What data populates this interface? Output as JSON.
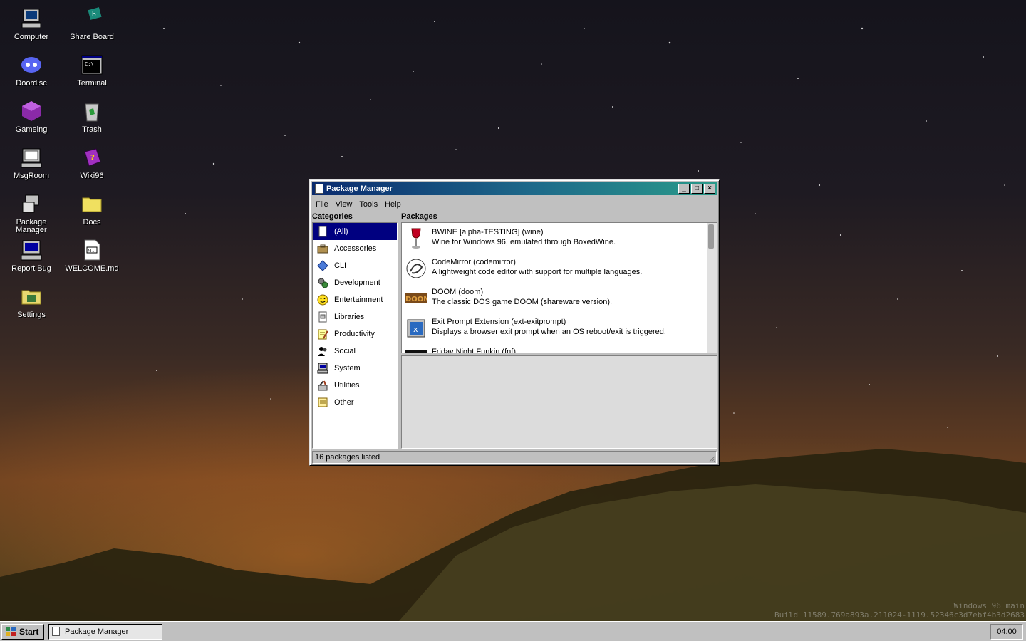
{
  "desktop": {
    "icons": [
      {
        "label": "Computer",
        "icon": "computer-icon"
      },
      {
        "label": "Share Board",
        "icon": "share-board-icon"
      },
      {
        "label": "Doordisc",
        "icon": "doordisc-icon"
      },
      {
        "label": "Terminal",
        "icon": "terminal-icon"
      },
      {
        "label": "Gameing",
        "icon": "gameing-icon"
      },
      {
        "label": "Trash",
        "icon": "trash-icon"
      },
      {
        "label": "MsgRoom",
        "icon": "msgroom-icon"
      },
      {
        "label": "Wiki96",
        "icon": "wiki-icon"
      },
      {
        "label": "Package Manager",
        "icon": "package-manager-icon"
      },
      {
        "label": "Docs",
        "icon": "folder-icon"
      },
      {
        "label": "Report Bug",
        "icon": "report-bug-icon"
      },
      {
        "label": "WELCOME.md",
        "icon": "markdown-file-icon"
      },
      {
        "label": "Settings",
        "icon": "settings-icon"
      }
    ]
  },
  "window": {
    "title": "Package Manager",
    "menu": [
      "File",
      "View",
      "Tools",
      "Help"
    ],
    "categories_label": "Categories",
    "packages_label": "Packages",
    "categories": [
      {
        "label": "(All)",
        "selected": true
      },
      {
        "label": "Accessories"
      },
      {
        "label": "CLI"
      },
      {
        "label": "Development"
      },
      {
        "label": "Entertainment"
      },
      {
        "label": "Libraries"
      },
      {
        "label": "Productivity"
      },
      {
        "label": "Social"
      },
      {
        "label": "System"
      },
      {
        "label": "Utilities"
      },
      {
        "label": "Other"
      }
    ],
    "packages": [
      {
        "name": "BWINE [alpha-TESTING] (wine)",
        "desc": "Wine for Windows 96, emulated through BoxedWine.",
        "icon": "wine-glass-icon"
      },
      {
        "name": "CodeMirror (codemirror)",
        "desc": "A lightweight code editor with support for multiple languages.",
        "icon": "codemirror-icon"
      },
      {
        "name": "DOOM (doom)",
        "desc": "The classic DOS game DOOM (shareware version).",
        "icon": "doom-icon"
      },
      {
        "name": "Exit Prompt Extension (ext-exitprompt)",
        "desc": "Displays a browser exit prompt when an OS reboot/exit is triggered.",
        "icon": "exit-prompt-icon"
      },
      {
        "name": "Friday Night Funkin (fnf)",
        "desc": "",
        "icon": "fnf-icon"
      }
    ],
    "status": "16 packages listed"
  },
  "watermark": {
    "line1": "Windows 96 main",
    "line2": "Build 11589.769a893a.211024-1119.52346c3d7ebf4b3d2683"
  },
  "taskbar": {
    "start_label": "Start",
    "task_label": "Package Manager",
    "clock": "04:00"
  }
}
